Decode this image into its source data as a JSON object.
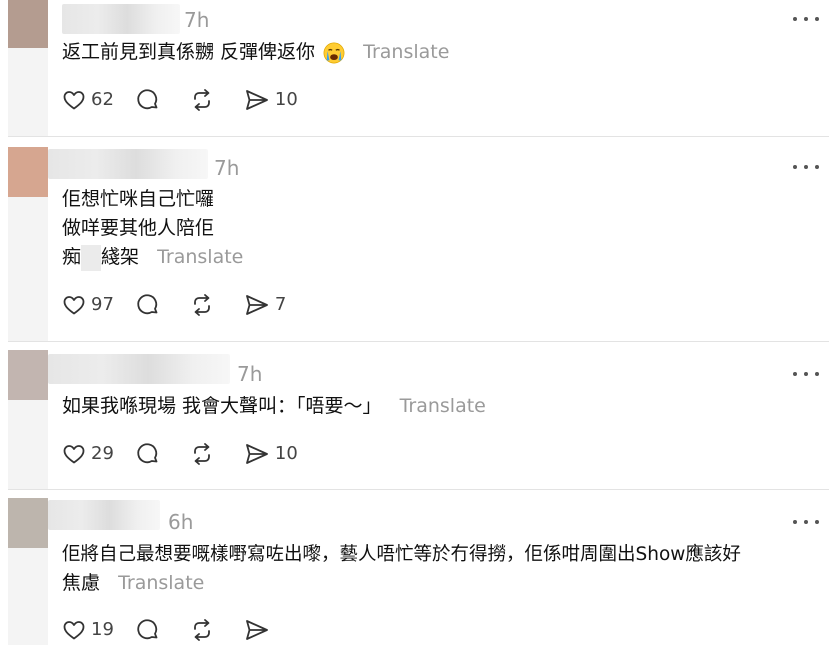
{
  "colors": {
    "avatar_1": "#b49c90",
    "avatar_2": "#d6a690",
    "avatar_3": "#c2b5b0",
    "avatar_4": "#bdb5ad",
    "muted_text": "#9a9a9a",
    "icon": "#333333"
  },
  "posts": [
    {
      "time": "7h",
      "text_lines": [
        "返工前見到真係嬲 反彈俾返你"
      ],
      "emoji": "crying-face-emoji",
      "translate": "Translate",
      "likes": "62",
      "shares": "10"
    },
    {
      "time": "7h",
      "text_lines": [
        "佢想忙咪自己忙囉",
        "做咩要其他人陪佢"
      ],
      "last_line_before": "痴",
      "last_line_after": "綫架",
      "translate": "Translate",
      "likes": "97",
      "shares": "7"
    },
    {
      "time": "7h",
      "text_lines": [
        "如果我喺現場 我會大聲叫：「唔要～」"
      ],
      "translate": "Translate",
      "likes": "29",
      "shares": "10"
    },
    {
      "time": "6h",
      "text_lines": [
        "佢將自己最想要嘅樣嘢寫咗出嚟，藝人唔忙等於冇得撈，佢係咁周圍出Show應該好"
      ],
      "last_line": "焦慮",
      "translate": "Translate",
      "likes": "19",
      "shares": ""
    }
  ]
}
